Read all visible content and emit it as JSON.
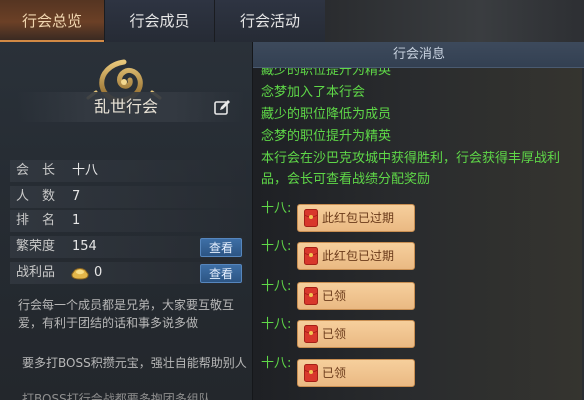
{
  "tabs": [
    {
      "label": "行会总览",
      "active": true
    },
    {
      "label": "行会成员",
      "active": false
    },
    {
      "label": "行会活动",
      "active": false
    }
  ],
  "guild": {
    "name": "乱世行会",
    "stats": [
      {
        "label": "会　长",
        "value": "十八"
      },
      {
        "label": "人　数",
        "value": "7"
      },
      {
        "label": "排　名",
        "value": "1"
      },
      {
        "label": "繁荣度",
        "value": "154",
        "button": "查看"
      },
      {
        "label": "战利品",
        "value": "0",
        "button": "查看"
      }
    ],
    "announcement": "行会每一个成员都是兄弟，大家要互敬互爱，有利于团结的话和事多说多做",
    "note": "要多打BOSS积攒元宝，强壮自能帮助别人",
    "note_cut": "打BOSS打行会战都要多抱团多组队"
  },
  "messages_panel": {
    "title": "行会消息",
    "lines": [
      "藏少的职位提升为精英",
      "念梦加入了本行会",
      "藏少的职位降低为成员",
      "念梦的职位提升为精英",
      "本行会在沙巴克攻城中获得胜利，行会获得丰厚战利品，会长可查看战绩分配奖励"
    ],
    "red_packets": [
      {
        "sender": "十八:",
        "status": "此红包已过期"
      },
      {
        "sender": "十八:",
        "status": "此红包已过期"
      },
      {
        "sender": "十八:",
        "status": "已领"
      },
      {
        "sender": "十八:",
        "status": "已领"
      },
      {
        "sender": "十八:",
        "status": "已领"
      }
    ]
  },
  "colors": {
    "accent_tab": "#6b4026",
    "message_green": "#5fd848",
    "button_blue": "#3e6fa6",
    "red_packet_bg": "#f6cf9c"
  },
  "icons": {
    "edit": "edit-icon",
    "emblem": "dragon-emblem-icon",
    "ingot": "gold-ingot-icon",
    "red_packet": "red-envelope-icon"
  }
}
